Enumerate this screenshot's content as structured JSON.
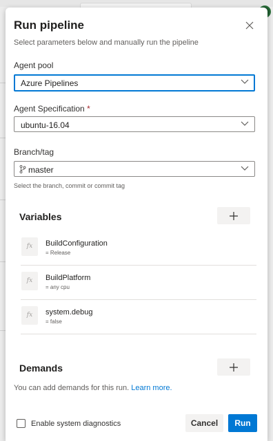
{
  "dialog": {
    "title": "Run pipeline",
    "subtitle": "Select parameters below and manually run the pipeline",
    "close_icon": "close-icon"
  },
  "agent_pool": {
    "label": "Agent pool",
    "value": "Azure Pipelines"
  },
  "agent_spec": {
    "label": "Agent Specification",
    "required_marker": "*",
    "value": "ubuntu-16.04"
  },
  "branch": {
    "label": "Branch/tag",
    "value": "master",
    "icon": "branch-icon",
    "hint": "Select the branch, commit or commit tag"
  },
  "variables": {
    "title": "Variables",
    "add_icon": "plus-icon",
    "items": [
      {
        "name": "BuildConfiguration",
        "value": "= Release",
        "icon_text": "fx"
      },
      {
        "name": "BuildPlatform",
        "value": "= any cpu",
        "icon_text": "fx"
      },
      {
        "name": "system.debug",
        "value": "= false",
        "icon_text": "fx"
      }
    ]
  },
  "demands": {
    "title": "Demands",
    "add_icon": "plus-icon",
    "text": "You can add demands for this run.",
    "link": "Learn more."
  },
  "footer": {
    "diagnostics_label": "Enable system diagnostics",
    "diagnostics_checked": false,
    "cancel_label": "Cancel",
    "run_label": "Run"
  },
  "colors": {
    "accent": "#0078d4",
    "required": "#a4262c"
  }
}
